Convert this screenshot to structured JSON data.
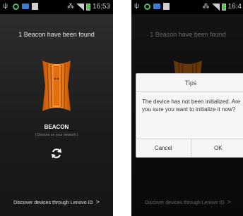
{
  "status_left": {
    "clock": "16:53"
  },
  "status_right": {
    "clock": "16:4"
  },
  "main": {
    "found_text": "1 Beacon have been found",
    "beacon_label": "BEACON",
    "beacon_subtitle": "( Devices on your network )",
    "discover_text": "Discover devices through Lenovo ID",
    "discover_chevron": ">"
  },
  "dialog": {
    "title": "Tips",
    "message": "The device has not been initialized. Are you sure you want to initialize it now?",
    "cancel_label": "Cancel",
    "ok_label": "OK"
  },
  "icons": {
    "status": [
      "usb-icon",
      "sync-icon",
      "message-icon",
      "image-icon",
      "wifi-icon",
      "signal-icon",
      "battery-icon"
    ],
    "refresh": "refresh-icon",
    "chevron": "chevron-right-icon"
  },
  "colors": {
    "beacon_orange": "#ff8a1f",
    "screen_dark": "#222222",
    "battery_green": "#53c253"
  }
}
